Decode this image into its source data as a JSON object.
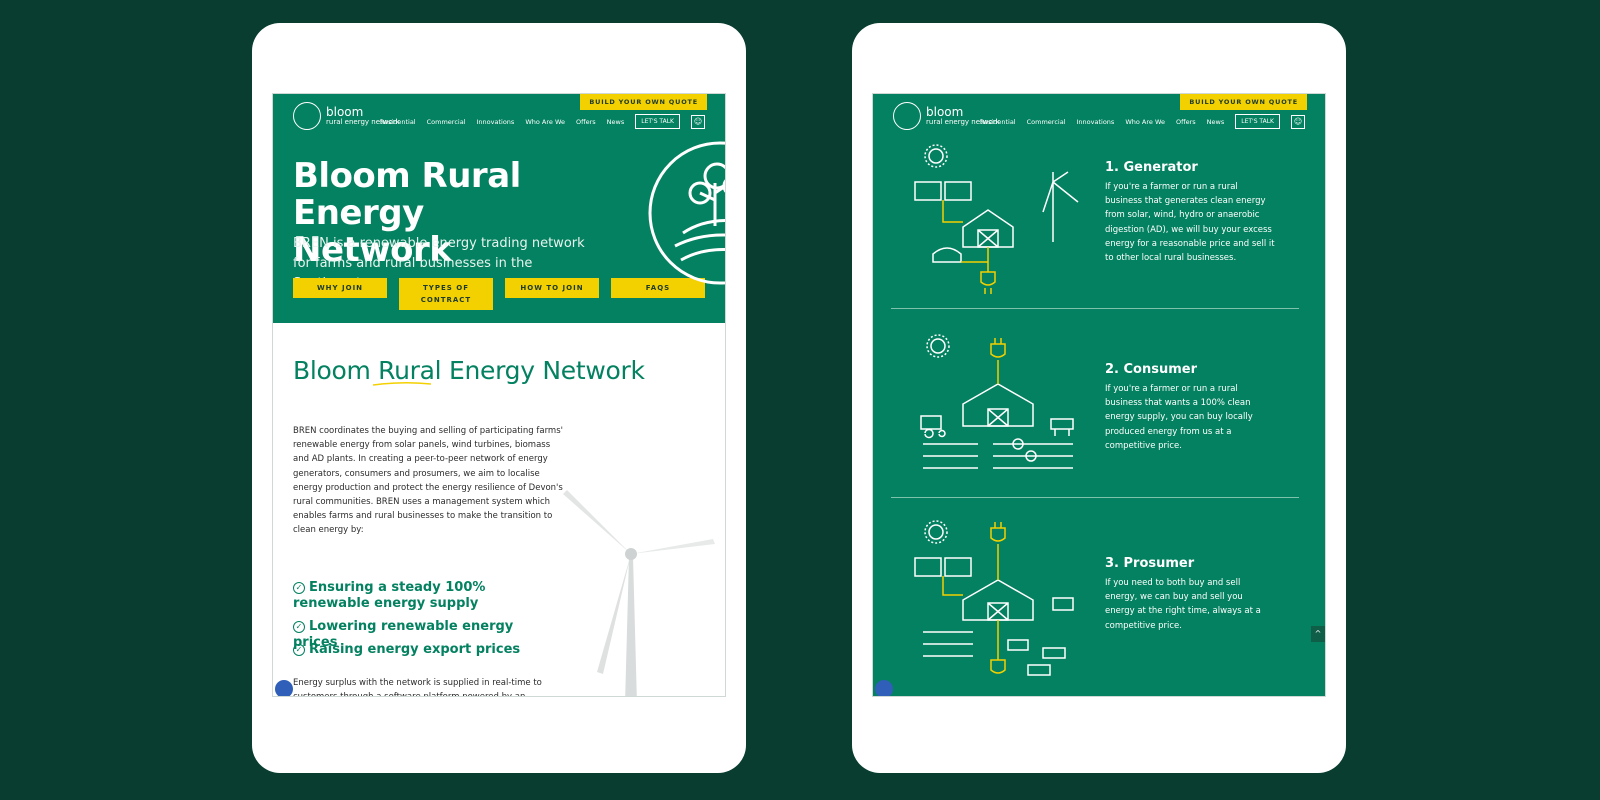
{
  "header": {
    "logo_brand": "bloom",
    "logo_sub": "rural energy network",
    "quote_button": "BUILD YOUR OWN QUOTE",
    "nav": [
      "Residential",
      "Commercial",
      "Innovations",
      "Who Are We",
      "Offers",
      "News"
    ],
    "lets_talk": "LET'S TALK"
  },
  "hero": {
    "title": "Bloom Rural Energy Network",
    "subtitle": "BREN is a renewable energy trading network for farms and rural businesses in the Southwest.",
    "buttons": [
      "WHY JOIN",
      "TYPES OF CONTRACT",
      "HOW TO JOIN",
      "FAQS"
    ]
  },
  "main": {
    "heading": "Bloom Rural Energy Network",
    "intro": "BREN coordinates the buying and selling of participating farms' renewable energy from solar panels, wind turbines, biomass and AD plants. In creating a peer-to-peer network of energy generators, consumers and prosumers, we aim to localise energy production and protect the energy resilience of Devon's rural communities. BREN uses a management system which enables farms and rural businesses to make the transition to clean energy by:",
    "benefits": [
      "Ensuring a steady 100% renewable energy supply",
      "Lowering renewable energy prices",
      "Raising energy export prices"
    ],
    "outro": "Energy surplus with the network is supplied in real-time to customers through a software platform powered by an established"
  },
  "roles": [
    {
      "title": "1. Generator",
      "text": "If you're a farmer or run a rural business that generates clean energy from solar, wind, hydro or anaerobic digestion (AD), we will buy your excess energy for a reasonable price and sell it to other local rural businesses."
    },
    {
      "title": "2. Consumer",
      "text": "If you're a farmer or run a rural business that wants a 100% clean energy supply, you can buy locally produced energy from us at a competitive price."
    },
    {
      "title": "3. Prosumer",
      "text": "If you need to both buy and sell energy, we can buy and sell you energy at the right time, always at a competitive price."
    }
  ],
  "colors": {
    "brand_green": "#038160",
    "accent_yellow": "#f3d000",
    "background": "#083d30"
  },
  "icons": {
    "scroll_top": "^",
    "user": "user-icon",
    "accessibility": "accessibility-icon"
  }
}
